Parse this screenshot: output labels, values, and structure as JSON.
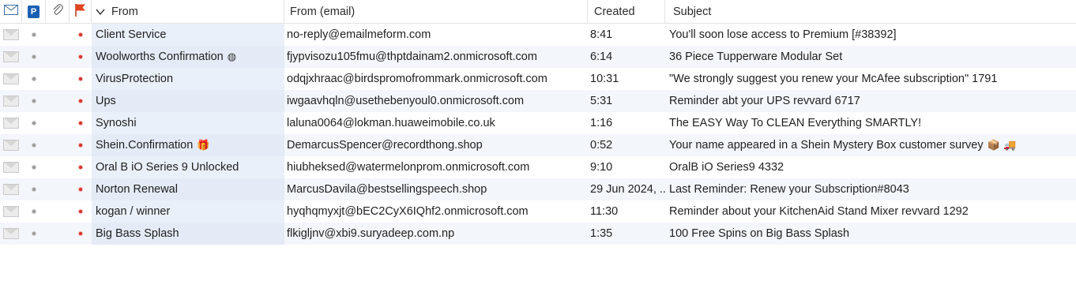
{
  "columns": {
    "from": "From",
    "email": "From (email)",
    "created": "Created",
    "subject": "Subject"
  },
  "icons": {
    "read": "envelope-icon",
    "priority": "priority-icon",
    "priority_letter": "P",
    "attachment": "paperclip-icon",
    "flag": "flag-icon",
    "sort": "sort-down-icon"
  },
  "colors": {
    "selected_column": "#eaf0f9",
    "flag_red": "#d6332b",
    "priority_blue": "#1a5fb4"
  },
  "messages": [
    {
      "from": "Client Service",
      "from_icon": "",
      "email": "no-reply@emailmeform.com",
      "created": "8:41",
      "subject": "You'll soon lose access to Premium [#38392]",
      "subject_icons": ""
    },
    {
      "from": "Woolworths Confirmation",
      "from_icon": "◍",
      "email": "fjypvisozu105fmu@thptdainam2.onmicrosoft.com",
      "created": "6:14",
      "subject": "36 Piece Tupperware Modular Set",
      "subject_icons": ""
    },
    {
      "from": "VirusProtection",
      "from_icon": "",
      "email": "odqjxhraac@birdspromofrommark.onmicrosoft.com",
      "created": "10:31",
      "subject": "\"We strongly suggest you renew your McAfee subscription\" 1791",
      "subject_icons": ""
    },
    {
      "from": "Ups",
      "from_icon": "",
      "email": "iwgaavhqln@usethebenyoul0.onmicrosoft.com",
      "created": "5:31",
      "subject": "Reminder abt your UPS revvard 6717",
      "subject_icons": ""
    },
    {
      "from": "Synoshi",
      "from_icon": "",
      "email": "laluna0064@lokman.huaweimobile.co.uk",
      "created": "1:16",
      "subject": "The EASY Way To CLEAN Everything SMARTLY!",
      "subject_icons": ""
    },
    {
      "from": "Shein.Confirmation",
      "from_icon": "🎁",
      "email": "DemarcusSpencer@recordthong.shop",
      "created": "0:52",
      "subject": "Your name appeared in a Shein Mystery Box  customer survey",
      "subject_icons": "📦 🚚"
    },
    {
      "from": "Oral B iO Series 9 Unlocked",
      "from_icon": "",
      "email": "hiubheksed@watermelonprom.onmicrosoft.com",
      "created": "9:10",
      "subject": "OralB iO Series9 4332",
      "subject_icons": ""
    },
    {
      "from": "Norton Renewal",
      "from_icon": "",
      "email": "MarcusDavila@bestsellingspeech.shop",
      "created": "29 Jun 2024, ...",
      "subject": "Last Reminder: Renew your Subscription#8043",
      "subject_icons": ""
    },
    {
      "from": "kogan / winner",
      "from_icon": "",
      "email": "hyqhqmyxjt@bEC2CyX6IQhf2.onmicrosoft.com",
      "created": "11:30",
      "subject": "Reminder about your KitchenAid Stand Mixer revvard 1292",
      "subject_icons": ""
    },
    {
      "from": "Big Bass Splash",
      "from_icon": "",
      "email": "flkigljnv@xbi9.suryadeep.com.np",
      "created": "1:35",
      "subject": "100 Free Spins on Big Bass Splash",
      "subject_icons": ""
    }
  ]
}
